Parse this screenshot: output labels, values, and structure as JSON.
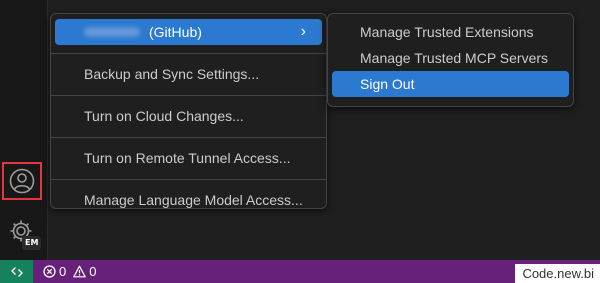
{
  "colors": {
    "accent": "#2b79d0",
    "status_bar": "#68217a",
    "remote": "#16825d",
    "highlight_border": "#e0383e"
  },
  "activity_bar": {
    "account_icon": "account-icon",
    "manage_icon": "gear-icon",
    "manage_badge": "EM"
  },
  "account_menu": {
    "account_label": "(GitHub)",
    "items": [
      "Backup and Sync Settings...",
      "Turn on Cloud Changes...",
      "Turn on Remote Tunnel Access...",
      "Manage Language Model Access..."
    ]
  },
  "submenu": {
    "items": [
      "Manage Trusted Extensions",
      "Manage Trusted MCP Servers",
      "Sign Out"
    ]
  },
  "status_bar": {
    "errors": "0",
    "warnings": "0",
    "watermark": "Code.new.bi"
  }
}
